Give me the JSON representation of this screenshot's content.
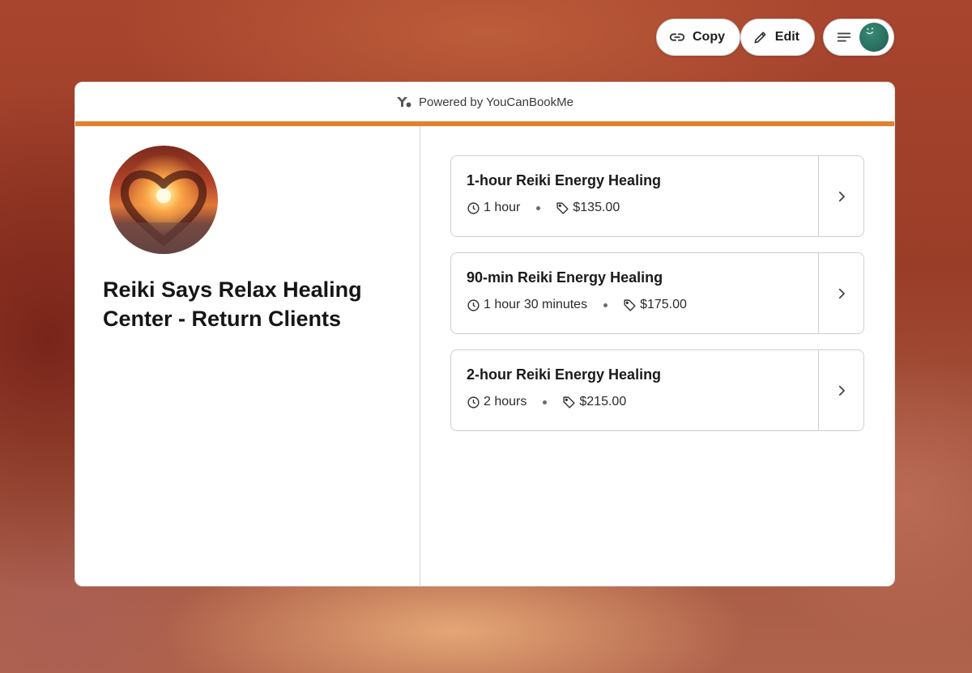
{
  "toolbar": {
    "copy_label": "Copy",
    "edit_label": "Edit",
    "copy_icon": "link-icon",
    "edit_icon": "pencil-icon",
    "menu_icon": "hamburger-icon"
  },
  "card": {
    "powered_by": "Powered by YouCanBookMe",
    "accent_color": "#e0822f"
  },
  "profile": {
    "title": "Reiki Says Relax Healing Center - Return Clients"
  },
  "services": [
    {
      "title": "1-hour Reiki Energy Healing",
      "duration": "1 hour",
      "price": "$135.00"
    },
    {
      "title": "90-min Reiki Energy Healing",
      "duration": "1 hour 30 minutes",
      "price": "$175.00"
    },
    {
      "title": "2-hour Reiki Energy Healing",
      "duration": "2 hours",
      "price": "$215.00"
    }
  ]
}
